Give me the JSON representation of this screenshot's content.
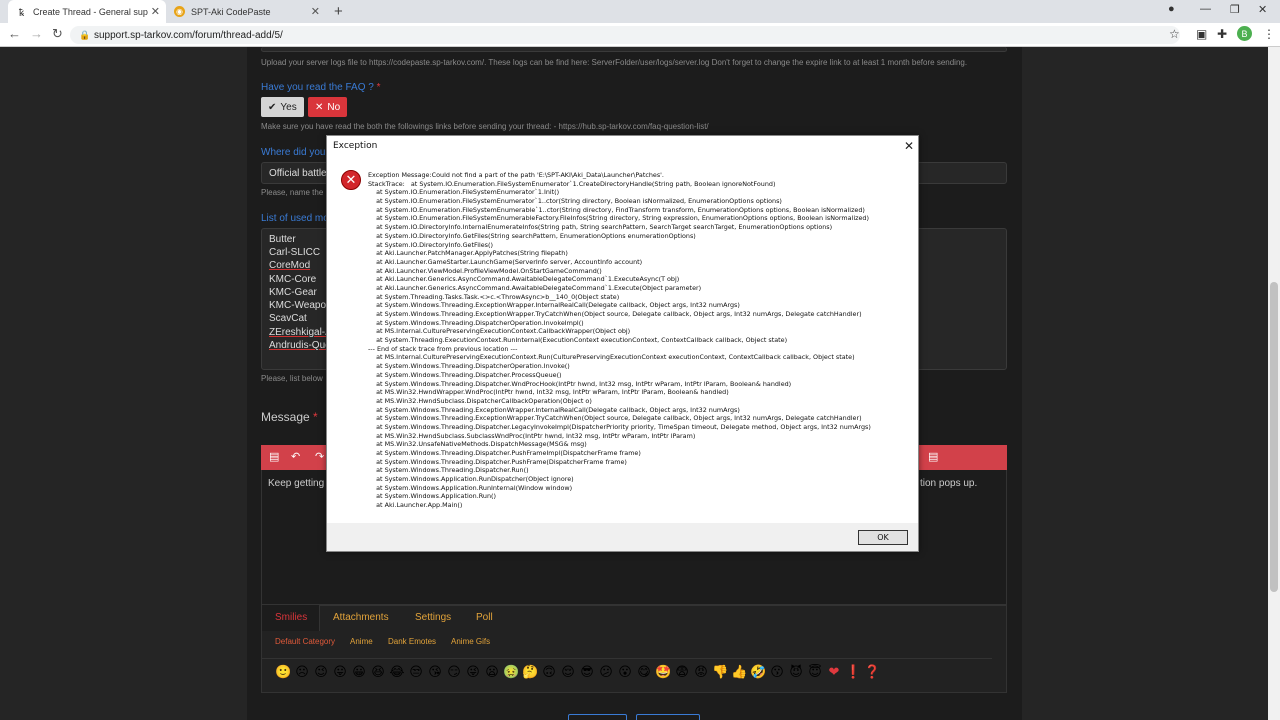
{
  "browser": {
    "tabs": [
      {
        "title": "Create Thread - General support",
        "active": true
      },
      {
        "title": "SPT-Aki CodePaste",
        "active": false
      }
    ],
    "url": "support.sp-tarkov.com/forum/thread-add/5/",
    "profile_initial": "B"
  },
  "form": {
    "server_logs_hint": "Upload your server logs file to https://codepaste.sp-tarkov.com/. These logs can be find here: ServerFolder/user/logs/server.log Don't forget to change the expire link to at least 1 month before sending.",
    "faq_label": "Have you read the FAQ ?",
    "required_mark": "*",
    "yes_label": "Yes",
    "no_label": "No",
    "faq_hint": "Make sure you have read the both the followings links before sending your thread: - https://hub.sp-tarkov.com/faq-question-list/",
    "where_label": "Where did you",
    "where_value": "Official battle",
    "where_hint": "Please, name the",
    "mods_label": "List of used mo",
    "mods": [
      "Butter",
      "Carl-SLICC",
      "CoreMod",
      "KMC-Core",
      "KMC-Gear",
      "KMC-Weapor",
      "ScavCat",
      "ZEreshkigal-A",
      "Andrudis-Que"
    ],
    "mods_hint": "Please, list below",
    "message_label": "Message",
    "message_text_left": "Keep getting t",
    "message_text_right": "tion pops up."
  },
  "bottom_tabs": [
    "Smilies",
    "Attachments",
    "Settings",
    "Poll"
  ],
  "smiley_categories": [
    "Default Category",
    "Anime",
    "Dank Emotes",
    "Anime Gifs"
  ],
  "smileys": [
    "🙂",
    "☹",
    "😉",
    "😛",
    "😀",
    "😆",
    "😂",
    "😒",
    "😘",
    "😏",
    "😜",
    "😦",
    "🤢",
    "🤔",
    "🙃",
    "😌",
    "😎",
    "😕",
    "😮",
    "😋",
    "🤩",
    "😨",
    "😡",
    "👎",
    "👍",
    "🤣",
    "😗",
    "😈",
    "😇",
    "❤",
    "❗",
    "❓"
  ],
  "dialog": {
    "title": "Exception",
    "ok_label": "OK",
    "message": "Exception Message:Could not find a part of the path 'E:\\SPT-AKI\\Aki_Data\\Launcher\\Patches'.\nStackTrace:   at System.IO.Enumeration.FileSystemEnumerator`1.CreateDirectoryHandle(String path, Boolean ignoreNotFound)\n    at System.IO.Enumeration.FileSystemEnumerator`1.Init()\n    at System.IO.Enumeration.FileSystemEnumerator`1..ctor(String directory, Boolean isNormalized, EnumerationOptions options)\n    at System.IO.Enumeration.FileSystemEnumerable`1..ctor(String directory, FindTransform transform, EnumerationOptions options, Boolean isNormalized)\n    at System.IO.Enumeration.FileSystemEnumerableFactory.FileInfos(String directory, String expression, EnumerationOptions options, Boolean isNormalized)\n    at System.IO.DirectoryInfo.InternalEnumerateInfos(String path, String searchPattern, SearchTarget searchTarget, EnumerationOptions options)\n    at System.IO.DirectoryInfo.GetFiles(String searchPattern, EnumerationOptions enumerationOptions)\n    at System.IO.DirectoryInfo.GetFiles()\n    at Aki.Launcher.PatchManager.ApplyPatches(String filepath)\n    at Aki.Launcher.GameStarter.LaunchGame(ServerInfo server, AccountInfo account)\n    at Aki.Launcher.ViewModel.ProfileViewModel.OnStartGameCommand()\n    at Aki.Launcher.Generics.AsyncCommand.AwaitableDelegateCommand`1.ExecuteAsync(T obj)\n    at Aki.Launcher.Generics.AsyncCommand.AwaitableDelegateCommand`1.Execute(Object parameter)\n    at System.Threading.Tasks.Task.<>c.<ThrowAsync>b__140_0(Object state)\n    at System.Windows.Threading.ExceptionWrapper.InternalRealCall(Delegate callback, Object args, Int32 numArgs)\n    at System.Windows.Threading.ExceptionWrapper.TryCatchWhen(Object source, Delegate callback, Object args, Int32 numArgs, Delegate catchHandler)\n    at System.Windows.Threading.DispatcherOperation.InvokeImpl()\n    at MS.Internal.CulturePreservingExecutionContext.CallbackWrapper(Object obj)\n    at System.Threading.ExecutionContext.RunInternal(ExecutionContext executionContext, ContextCallback callback, Object state)\n--- End of stack trace from previous location ---\n    at MS.Internal.CulturePreservingExecutionContext.Run(CulturePreservingExecutionContext executionContext, ContextCallback callback, Object state)\n    at System.Windows.Threading.DispatcherOperation.Invoke()\n    at System.Windows.Threading.Dispatcher.ProcessQueue()\n    at System.Windows.Threading.Dispatcher.WndProcHook(IntPtr hwnd, Int32 msg, IntPtr wParam, IntPtr lParam, Boolean& handled)\n    at MS.Win32.HwndWrapper.WndProc(IntPtr hwnd, Int32 msg, IntPtr wParam, IntPtr lParam, Boolean& handled)\n    at MS.Win32.HwndSubclass.DispatcherCallbackOperation(Object o)\n    at System.Windows.Threading.ExceptionWrapper.InternalRealCall(Delegate callback, Object args, Int32 numArgs)\n    at System.Windows.Threading.ExceptionWrapper.TryCatchWhen(Object source, Delegate callback, Object args, Int32 numArgs, Delegate catchHandler)\n    at System.Windows.Threading.Dispatcher.LegacyInvokeImpl(DispatcherPriority priority, TimeSpan timeout, Delegate method, Object args, Int32 numArgs)\n    at MS.Win32.HwndSubclass.SubclassWndProc(IntPtr hwnd, Int32 msg, IntPtr wParam, IntPtr lParam)\n    at MS.Win32.UnsafeNativeMethods.DispatchMessage(MSG& msg)\n    at System.Windows.Threading.Dispatcher.PushFrameImpl(DispatcherFrame frame)\n    at System.Windows.Threading.Dispatcher.PushFrame(DispatcherFrame frame)\n    at System.Windows.Threading.Dispatcher.Run()\n    at System.Windows.Application.RunDispatcher(Object ignore)\n    at System.Windows.Application.RunInternal(Window window)\n    at System.Windows.Application.Run()\n    at Aki.Launcher.App.Main()"
  }
}
